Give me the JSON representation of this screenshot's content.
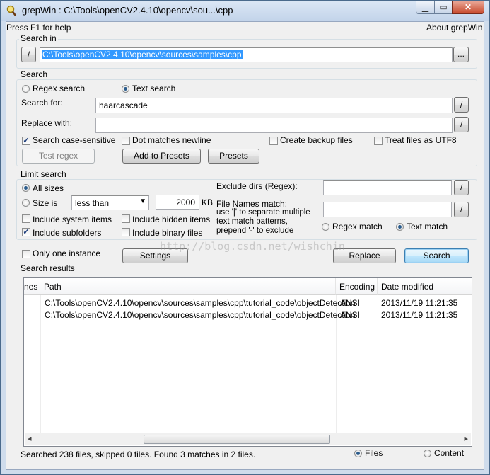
{
  "window": {
    "title": "grepWin : C:\\Tools\\openCV2.4.10\\opencv\\sou...\\cpp",
    "help_hint": "Press F1 for help",
    "about_link": "About grepWin",
    "min_glyph": "▁",
    "max_glyph": "▭",
    "close_glyph": "✕"
  },
  "search_in": {
    "label": "Search in",
    "slash_button": "/",
    "path": "C:\\Tools\\openCV2.4.10\\opencv\\sources\\samples\\cpp",
    "browse_button": "..."
  },
  "search": {
    "label": "Search",
    "regex_label": "Regex search",
    "text_label": "Text search",
    "search_for_label": "Search for:",
    "search_for_value": "haarcascade",
    "replace_label": "Replace with:",
    "replace_value": "",
    "slash_button": "/",
    "case_sensitive": "Search case-sensitive",
    "dot_newline": "Dot matches newline",
    "backup_files": "Create backup files",
    "utf8": "Treat files as UTF8",
    "test_regex": "Test regex",
    "add_presets": "Add to Presets",
    "presets": "Presets"
  },
  "limit": {
    "label": "Limit search",
    "all_sizes": "All sizes",
    "size_is": "Size is",
    "size_op": "less than",
    "size_value": "2000",
    "size_unit": "KB",
    "system_items": "Include system items",
    "hidden_items": "Include hidden items",
    "subfolders": "Include subfolders",
    "binary_files": "Include binary files",
    "exclude_dirs_label": "Exclude dirs (Regex):",
    "exclude_dirs_value": "",
    "file_names_label": "File Names match:",
    "file_names_hint1": "use '|' to separate multiple",
    "file_names_hint2": "text match patterns,",
    "file_names_hint3": "prepend '-' to exclude",
    "file_names_value": "",
    "regex_match": "Regex match",
    "text_match": "Text match",
    "slash_button": "/"
  },
  "actions": {
    "only_one_instance": "Only one instance",
    "settings": "Settings",
    "replace": "Replace",
    "search": "Search"
  },
  "results": {
    "label": "Search results",
    "columns": [
      "nes",
      "Path",
      "Encoding",
      "Date modified"
    ],
    "rows": [
      {
        "path": "C:\\Tools\\openCV2.4.10\\opencv\\sources\\samples\\cpp\\tutorial_code\\objectDetection",
        "encoding": "ANSI",
        "date": "2013/11/19 11:21:35"
      },
      {
        "path": "C:\\Tools\\openCV2.4.10\\opencv\\sources\\samples\\cpp\\tutorial_code\\objectDetection",
        "encoding": "ANSI",
        "date": "2013/11/19 11:21:35"
      }
    ],
    "scroll_left": "◂",
    "scroll_right": "▸"
  },
  "status": {
    "text": "Searched 238 files, skipped 0 files. Found 3 matches in 2 files.",
    "files_label": "Files",
    "content_label": "Content"
  },
  "watermark": "http://blog.csdn.net/wishchin"
}
